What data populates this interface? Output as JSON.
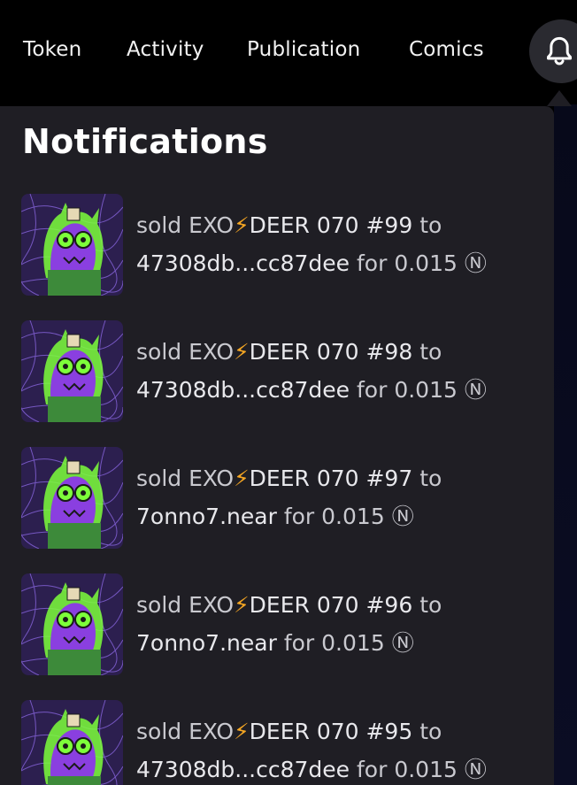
{
  "nav": {
    "items": [
      "Token",
      "Activity",
      "Publication",
      "Comics"
    ],
    "bell_icon": "bell-icon"
  },
  "panel": {
    "title": "Notifications"
  },
  "notifications": [
    {
      "action": "sold EXO",
      "bolt": "⚡",
      "name": "DEER 070 #99",
      "to": "to",
      "recipient": "47308db...cc87dee",
      "for": "for 0.015",
      "currency": "Ⓝ"
    },
    {
      "action": "sold EXO",
      "bolt": "⚡",
      "name": "DEER 070 #98",
      "to": "to",
      "recipient": "47308db...cc87dee",
      "for": "for 0.015",
      "currency": "Ⓝ"
    },
    {
      "action": "sold EXO",
      "bolt": "⚡",
      "name": "DEER 070 #97",
      "to": "to",
      "recipient": "7onno7.near",
      "for": "for 0.015",
      "currency": "Ⓝ"
    },
    {
      "action": "sold EXO",
      "bolt": "⚡",
      "name": "DEER 070 #96",
      "to": "to",
      "recipient": "7onno7.near",
      "for": "for 0.015",
      "currency": "Ⓝ"
    },
    {
      "action": "sold EXO",
      "bolt": "⚡",
      "name": "DEER 070 #95",
      "to": "to",
      "recipient": "47308db...cc87dee",
      "for": "for 0.015",
      "currency": "Ⓝ"
    }
  ],
  "colors": {
    "nav_bg": "#000000",
    "panel_bg": "#1f1e24",
    "bolt": "#f5a623",
    "thumb_purple": "#7b3fd6",
    "thumb_green": "#7dff3a"
  }
}
